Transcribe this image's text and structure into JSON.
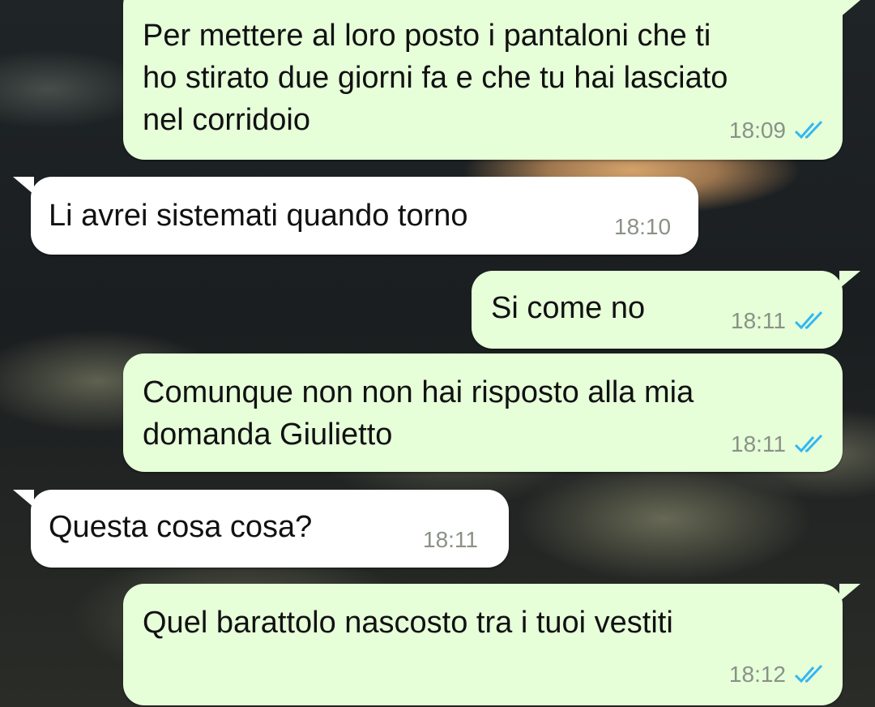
{
  "colors": {
    "outgoing_bubble": "#e6ffd9",
    "incoming_bubble": "#ffffff",
    "read_ticks": "#34b7f1",
    "timestamp": "#8a9286"
  },
  "messages": [
    {
      "direction": "outgoing",
      "text": "Per mettere al loro posto i pantaloni che ti\nho stirato due giorni fa e che tu hai lasciato\nnel corridoio",
      "time": "18:09",
      "status": "read"
    },
    {
      "direction": "incoming",
      "text": "Li avrei sistemati quando torno",
      "time": "18:10"
    },
    {
      "direction": "outgoing",
      "text": "Si come no",
      "time": "18:11",
      "status": "read"
    },
    {
      "direction": "outgoing",
      "text": "Comunque non non hai risposto alla mia\ndomanda Giulietto",
      "time": "18:11",
      "status": "read"
    },
    {
      "direction": "incoming",
      "text": "Questa cosa cosa?",
      "time": "18:11"
    },
    {
      "direction": "outgoing",
      "text": "Quel barattolo nascosto tra i tuoi vestiti",
      "time": "18:12",
      "status": "read"
    }
  ],
  "icons": {
    "read_receipt": "double-check-icon"
  }
}
